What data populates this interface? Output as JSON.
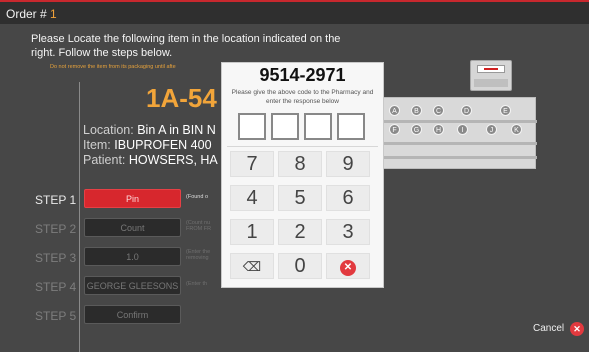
{
  "header": {
    "order_label": "Order #",
    "order_number": "1"
  },
  "instructions": {
    "text": "Please Locate the following item in the location indicated on the right. Follow the steps below.",
    "warning": "Do not remove the item from its packaging until afte"
  },
  "item": {
    "bin_code": "1A-54",
    "location_label": "Location:",
    "location_value": "Bin A in BIN N",
    "item_label": "Item:",
    "item_value": "IBUPROFEN 400",
    "patient_label": "Patient:",
    "patient_value": "HOWSERS, HA"
  },
  "steps": [
    {
      "label": "STEP 1",
      "button": "Pin",
      "hint": "(Found o",
      "active": true
    },
    {
      "label": "STEP 2",
      "button": "Count",
      "hint": "(Count nu FROM FR",
      "active": false
    },
    {
      "label": "STEP 3",
      "button": "1.0",
      "hint": "(Enter the removing",
      "active": false
    },
    {
      "label": "STEP 4",
      "button": "GEORGE GLEESONS",
      "hint": "(Enter th",
      "active": false
    },
    {
      "label": "STEP 5",
      "button": "Confirm",
      "hint": "",
      "active": false
    }
  ],
  "cabinet": {
    "row1": [
      "A",
      "B",
      "C",
      "D",
      "E"
    ],
    "row2": [
      "F",
      "G",
      "H",
      "I",
      "J",
      "K"
    ],
    "accent": "#d7272d"
  },
  "dialog": {
    "code": "9514-2971",
    "hint": "Please give the above code to the Pharmacy and enter the response below",
    "keys": [
      "7",
      "8",
      "9",
      "4",
      "5",
      "6",
      "1",
      "2",
      "3",
      "⌫",
      "0",
      "✕"
    ]
  },
  "footer": {
    "cancel_label": "Cancel"
  },
  "colors": {
    "accent_red": "#d7272d",
    "orange": "#f2a53a",
    "background": "#474747"
  }
}
